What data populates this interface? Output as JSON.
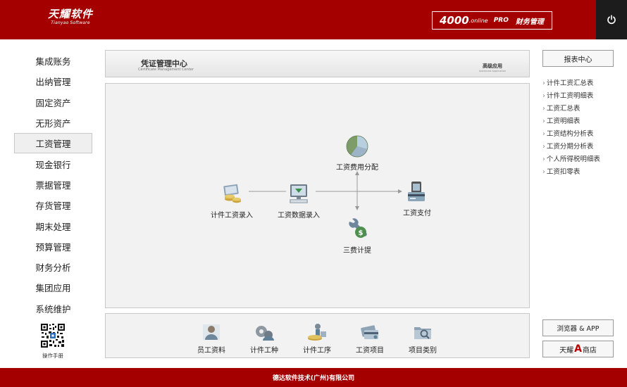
{
  "header": {
    "logo_main": "天耀软件",
    "logo_sub": "Tianyao Software",
    "product_number": "4000",
    "product_online": ".online",
    "product_pro": "PRO",
    "product_name": "财务管理"
  },
  "nav": {
    "items": [
      {
        "label": "集成账务"
      },
      {
        "label": "出纳管理"
      },
      {
        "label": "固定资产"
      },
      {
        "label": "无形资产"
      },
      {
        "label": "工资管理",
        "active": true
      },
      {
        "label": "现金银行"
      },
      {
        "label": "票据管理"
      },
      {
        "label": "存货管理"
      },
      {
        "label": "期末处理"
      },
      {
        "label": "预算管理"
      },
      {
        "label": "财务分析"
      },
      {
        "label": "集团应用"
      },
      {
        "label": "系统维护"
      }
    ],
    "manual_label": "操作手册"
  },
  "titlebar": {
    "title": "凭证管理中心",
    "subtitle": "Certificate Management Center",
    "advanced": "高级应用",
    "advanced_sub": "Advanced Application"
  },
  "flow": {
    "piece_entry": "计件工资录入",
    "data_entry": "工资数据录入",
    "cost_allocation": "工资费用分配",
    "three_fees": "三费计提",
    "payment": "工资支付"
  },
  "bottom": {
    "items": [
      "员工资料",
      "计件工种",
      "计件工序",
      "工资项目",
      "项目类别"
    ]
  },
  "right": {
    "report_center": "报表中心",
    "reports": [
      "计件工资汇总表",
      "计件工资明细表",
      "工资汇总表",
      "工资明细表",
      "工资结构分析表",
      "工资分期分析表",
      "个人所得税明细表",
      "工资扣零表"
    ],
    "browser_app": "浏览器 & APP",
    "store_pre": "天耀",
    "store_a": "A",
    "store_post": "商店"
  },
  "footer": {
    "text": "德达软件技术(广州)有限公司"
  },
  "colors": {
    "brand_red": "#a40000",
    "power_bg": "#1c1c1c"
  }
}
